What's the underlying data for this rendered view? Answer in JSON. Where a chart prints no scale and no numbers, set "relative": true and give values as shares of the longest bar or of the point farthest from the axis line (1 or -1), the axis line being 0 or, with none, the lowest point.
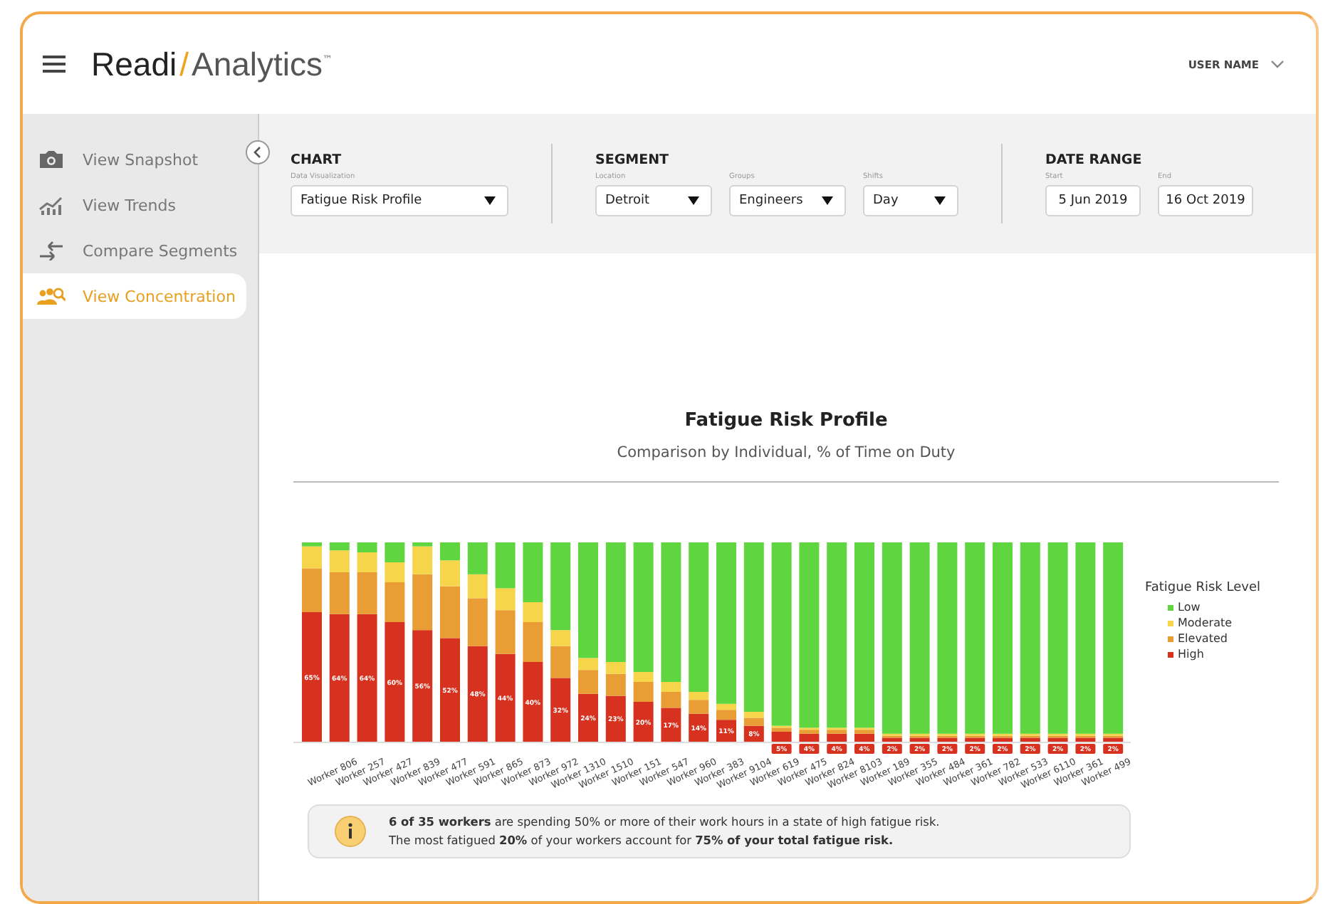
{
  "header": {
    "logo": {
      "brand": "Readi",
      "separator": "/",
      "product": "Analytics",
      "mark": "™"
    },
    "user": "USER NAME"
  },
  "sidebar": {
    "items": [
      {
        "label": "View Snapshot",
        "selected": false
      },
      {
        "label": "View Trends",
        "selected": false
      },
      {
        "label": "Compare Segments",
        "selected": false
      },
      {
        "label": "View Concentration",
        "selected": true
      }
    ]
  },
  "filters": [
    {
      "title": "CHART",
      "fields": [
        {
          "label": "Data Visualization",
          "value": "Fatigue Risk Profile",
          "kind": "dropdown"
        }
      ]
    },
    {
      "title": "SEGMENT",
      "fields": [
        {
          "label": "Location",
          "value": "Detroit",
          "kind": "dropdown"
        },
        {
          "label": "Groups",
          "value": "Engineers",
          "kind": "dropdown"
        },
        {
          "label": "Shifts",
          "value": "Day",
          "kind": "dropdown"
        }
      ]
    },
    {
      "title": "DATE RANGE",
      "fields": [
        {
          "label": "Start",
          "value": "5 Jun 2019",
          "kind": "date"
        },
        {
          "label": "End",
          "value": "16 Oct 2019",
          "kind": "date"
        }
      ]
    }
  ],
  "chart": {
    "title": "Fatigue Risk Profile",
    "subtitle": "Comparison by Individual, % of Time on Duty",
    "legend_title": "Fatigue Risk Level",
    "chart_data": {
      "type": "bar",
      "stacked": true,
      "orientation": "vertical",
      "categories": [
        null,
        "Worker 806",
        "Worker 257",
        "Worker 427",
        "Worker 839",
        "Worker 477",
        "Worker 591",
        "Worker 865",
        "Worker 873",
        "Worker 972",
        "Worker 1310",
        "Worker 1510",
        "Worker 151",
        "Worker 547",
        "Worker 960",
        "Worker 383",
        "Worker 9104",
        "Worker 619",
        "Worker 475",
        "Worker 824",
        "Worker 8103",
        "Worker 189",
        "Worker 355",
        "Worker 484",
        "Worker 361",
        "Worker 782",
        "Worker 533",
        "Worker 6110",
        "Worker 361",
        "Worker 499"
      ],
      "series": [
        {
          "name": "High",
          "color": "#d7321f",
          "values": [
            0.65,
            0.64,
            0.64,
            0.6,
            0.56,
            0.52,
            0.48,
            0.44,
            0.4,
            0.32,
            0.24,
            0.23,
            0.2,
            0.17,
            0.14,
            0.11,
            0.08,
            0.05,
            0.04,
            0.04,
            0.04,
            0.02,
            0.02,
            0.02,
            0.02,
            0.02,
            0.02,
            0.02,
            0.02,
            0.02
          ]
        },
        {
          "name": "Elevated",
          "color": "#e89e34",
          "values": [
            0.22,
            0.21,
            0.21,
            0.2,
            0.28,
            0.26,
            0.24,
            0.22,
            0.2,
            0.16,
            0.12,
            0.11,
            0.1,
            0.08,
            0.07,
            0.05,
            0.04,
            0.02,
            0.02,
            0.02,
            0.02,
            0.01,
            0.01,
            0.01,
            0.01,
            0.01,
            0.01,
            0.01,
            0.01,
            0.01
          ]
        },
        {
          "name": "Moderate",
          "color": "#f7d54a",
          "values": [
            0.11,
            0.11,
            0.1,
            0.1,
            0.14,
            0.13,
            0.12,
            0.11,
            0.1,
            0.08,
            0.06,
            0.06,
            0.05,
            0.05,
            0.04,
            0.03,
            0.03,
            0.01,
            0.01,
            0.01,
            0.01,
            0.01,
            0.01,
            0.01,
            0.01,
            0.01,
            0.01,
            0.01,
            0.01,
            0.01
          ]
        },
        {
          "name": "Low",
          "color": "#5fd63f",
          "values": [
            0.02,
            0.04,
            0.05,
            0.1,
            0.02,
            0.09,
            0.16,
            0.23,
            0.3,
            0.44,
            0.58,
            0.6,
            0.65,
            0.7,
            0.75,
            0.81,
            0.85,
            0.92,
            0.93,
            0.93,
            0.93,
            0.96,
            0.96,
            0.96,
            0.96,
            0.96,
            0.96,
            0.96,
            0.96,
            0.96
          ]
        }
      ],
      "value_labels": [
        "65%",
        "64%",
        "64%",
        "60%",
        "56%",
        "52%",
        "48%",
        "44%",
        "40%",
        "32%",
        "24%",
        "23%",
        "20%",
        "17%",
        "14%",
        "11%",
        "8%",
        "5%",
        "4%",
        "4%",
        "4%",
        "2%",
        "2%",
        "2%",
        "2%",
        "2%",
        "2%",
        "2%",
        "2%",
        "2%"
      ],
      "ylim": [
        0,
        1
      ],
      "relative": true
    }
  },
  "note": {
    "lines": [
      "**6 of 35 workers** are spending 50% or more of their work hours in a state of  high fatigue risk.",
      "The most fatigued **20%** of your workers account for **75% of your total fatigue risk.**"
    ]
  }
}
